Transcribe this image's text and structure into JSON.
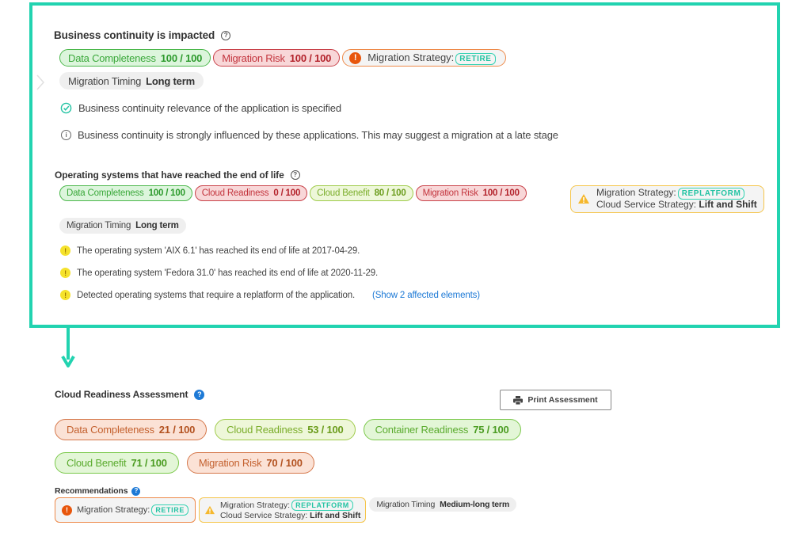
{
  "business_continuity": {
    "title": "Business continuity is impacted",
    "scores": [
      {
        "label": "Data Completeness",
        "value": "100 / 100",
        "tone": "green"
      },
      {
        "label": "Migration Risk",
        "value": "100 / 100",
        "tone": "red"
      }
    ],
    "strategy": {
      "label": "Migration Strategy:",
      "tag": "RETIRE",
      "severity": "error"
    },
    "timing": {
      "label": "Migration Timing",
      "value": "Long term"
    },
    "messages": [
      {
        "icon": "check-circle-icon",
        "text": "Business continuity relevance of the application is specified"
      },
      {
        "icon": "info-circle-icon",
        "text": "Business continuity is strongly influenced by these applications. This may suggest a migration at a late stage"
      }
    ]
  },
  "eol_os": {
    "title": "Operating systems that have reached the end of life",
    "scores": [
      {
        "label": "Data Completeness",
        "value": "100 / 100",
        "tone": "green"
      },
      {
        "label": "Cloud Readiness",
        "value": "0 / 100",
        "tone": "red"
      },
      {
        "label": "Cloud Benefit",
        "value": "80 / 100",
        "tone": "lime"
      },
      {
        "label": "Migration Risk",
        "value": "100 / 100",
        "tone": "red"
      }
    ],
    "strategy": {
      "label": "Migration Strategy:",
      "tag": "REPLATFORM",
      "cloud_label": "Cloud Service Strategy:",
      "cloud_value": "Lift and Shift",
      "severity": "warning"
    },
    "timing": {
      "label": "Migration Timing",
      "value": "Long term"
    },
    "messages": [
      {
        "icon": "warning-dot-icon",
        "text": "The operating system 'AIX 6.1' has reached its end of life at 2017-04-29."
      },
      {
        "icon": "warning-dot-icon",
        "text": "The operating system 'Fedora 31.0' has reached its end of life at 2020-11-29."
      },
      {
        "icon": "warning-dot-icon",
        "text": "Detected operating systems that require a replatform of the application.",
        "link": "(Show 2 affected elements)"
      }
    ]
  },
  "assessment": {
    "title": "Cloud Readiness Assessment",
    "print_label": "Print Assessment",
    "scores_row1": [
      {
        "label": "Data Completeness",
        "value": "21 / 100",
        "tone": "orange"
      },
      {
        "label": "Cloud Readiness",
        "value": "53 / 100",
        "tone": "lime"
      },
      {
        "label": "Container Readiness",
        "value": "75 / 100",
        "tone": "lgreen"
      }
    ],
    "scores_row2": [
      {
        "label": "Cloud Benefit",
        "value": "71 / 100",
        "tone": "lgreen"
      },
      {
        "label": "Migration Risk",
        "value": "70 / 100",
        "tone": "orange"
      }
    ],
    "recommendations_title": "Recommendations",
    "recommendations": {
      "retire": {
        "label": "Migration Strategy:",
        "tag": "RETIRE"
      },
      "replatform": {
        "label": "Migration Strategy:",
        "tag": "REPLATFORM",
        "cloud_label": "Cloud Service Strategy:",
        "cloud_value": "Lift and Shift"
      },
      "timing": {
        "label": "Migration Timing",
        "value": "Medium-long term"
      }
    }
  },
  "colors": {
    "highlight": "#22d3b0",
    "link": "#1e7ad6",
    "tag": "#23c3a3"
  }
}
